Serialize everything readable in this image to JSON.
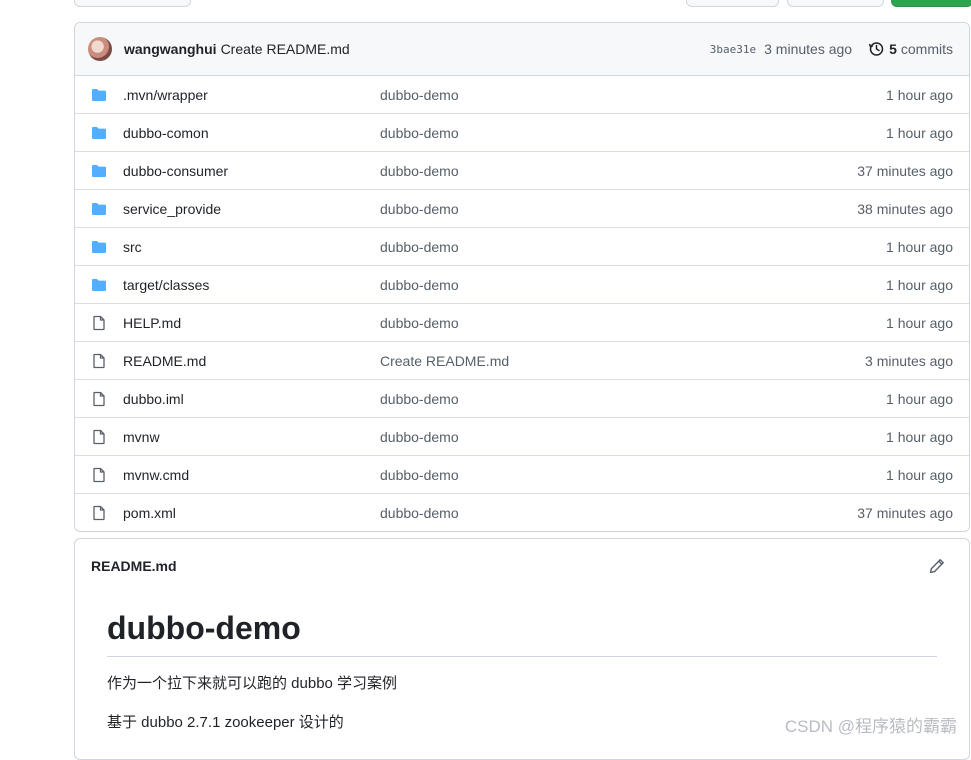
{
  "commit_bar": {
    "author": "wangwanghui",
    "message": "Create README.md",
    "sha": "3bae31e",
    "time": "3 minutes ago",
    "commits_count": "5",
    "commits_label": "commits"
  },
  "files": [
    {
      "type": "folder",
      "name": ".mvn/wrapper",
      "message": "dubbo-demo",
      "age": "1 hour ago"
    },
    {
      "type": "folder",
      "name": "dubbo-comon",
      "message": "dubbo-demo",
      "age": "1 hour ago"
    },
    {
      "type": "folder",
      "name": "dubbo-consumer",
      "message": "dubbo-demo",
      "age": "37 minutes ago"
    },
    {
      "type": "folder",
      "name": "service_provide",
      "message": "dubbo-demo",
      "age": "38 minutes ago"
    },
    {
      "type": "folder",
      "name": "src",
      "message": "dubbo-demo",
      "age": "1 hour ago"
    },
    {
      "type": "folder",
      "name": "target/classes",
      "message": "dubbo-demo",
      "age": "1 hour ago"
    },
    {
      "type": "file",
      "name": "HELP.md",
      "message": "dubbo-demo",
      "age": "1 hour ago"
    },
    {
      "type": "file",
      "name": "README.md",
      "message": "Create README.md",
      "age": "3 minutes ago"
    },
    {
      "type": "file",
      "name": "dubbo.iml",
      "message": "dubbo-demo",
      "age": "1 hour ago"
    },
    {
      "type": "file",
      "name": "mvnw",
      "message": "dubbo-demo",
      "age": "1 hour ago"
    },
    {
      "type": "file",
      "name": "mvnw.cmd",
      "message": "dubbo-demo",
      "age": "1 hour ago"
    },
    {
      "type": "file",
      "name": "pom.xml",
      "message": "dubbo-demo",
      "age": "37 minutes ago"
    }
  ],
  "readme": {
    "filename": "README.md",
    "title": "dubbo-demo",
    "paragraphs": [
      "作为一个拉下来就可以跑的 dubbo 学习案例",
      "基于 dubbo 2.7.1 zookeeper 设计的"
    ]
  },
  "watermark": "CSDN @程序猿的霸霸",
  "colors": {
    "folder_icon": "#54aeff",
    "file_icon": "#57606a",
    "primary_button": "#2da44e"
  },
  "icons": {
    "folder": "folder-icon",
    "file": "file-icon",
    "history": "history-icon",
    "edit": "pencil-icon"
  }
}
